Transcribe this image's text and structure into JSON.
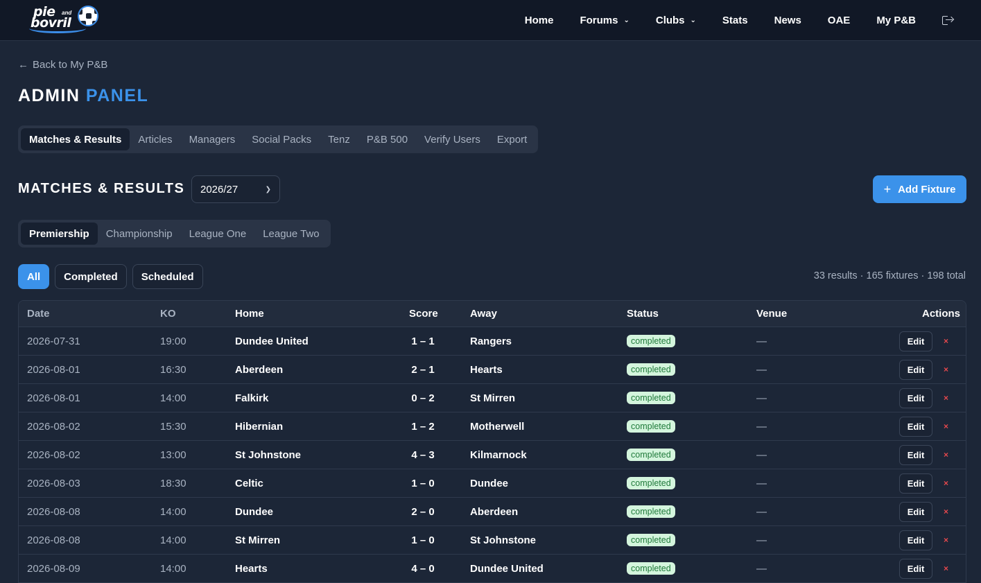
{
  "nav": {
    "logo": {
      "line1": "pie",
      "line2": "bovril",
      "small": "and"
    },
    "items": [
      {
        "label": "Home",
        "dropdown": false
      },
      {
        "label": "Forums",
        "dropdown": true
      },
      {
        "label": "Clubs",
        "dropdown": true
      },
      {
        "label": "Stats",
        "dropdown": false
      },
      {
        "label": "News",
        "dropdown": false
      },
      {
        "label": "OAE",
        "dropdown": false
      },
      {
        "label": "My P&B",
        "dropdown": false
      }
    ],
    "logout_icon": "logout-icon"
  },
  "back_link": "Back to My P&B",
  "title": {
    "main": "ADMIN",
    "accent": "PANEL"
  },
  "tabs": [
    "Matches & Results",
    "Articles",
    "Managers",
    "Social Packs",
    "Tenz",
    "P&B 500",
    "Verify Users",
    "Export"
  ],
  "active_tab": 0,
  "section": {
    "title": "MATCHES & RESULTS",
    "season": "2026/27",
    "add_button": "Add Fixture"
  },
  "leagues": [
    "Premiership",
    "Championship",
    "League One",
    "League Two"
  ],
  "active_league": 0,
  "filters": [
    "All",
    "Completed",
    "Scheduled"
  ],
  "active_filter": 0,
  "summary": "33 results · 165 fixtures · 198 total",
  "table": {
    "headers": {
      "date": "Date",
      "ko": "KO",
      "home": "Home",
      "score": "Score",
      "away": "Away",
      "status": "Status",
      "venue": "Venue",
      "actions": "Actions"
    },
    "edit_label": "Edit",
    "delete_label": "×",
    "rows": [
      {
        "date": "2026-07-31",
        "ko": "19:00",
        "home": "Dundee United",
        "score": "1 – 1",
        "away": "Rangers",
        "status": "completed",
        "venue": "—"
      },
      {
        "date": "2026-08-01",
        "ko": "16:30",
        "home": "Aberdeen",
        "score": "2 – 1",
        "away": "Hearts",
        "status": "completed",
        "venue": "—"
      },
      {
        "date": "2026-08-01",
        "ko": "14:00",
        "home": "Falkirk",
        "score": "0 – 2",
        "away": "St Mirren",
        "status": "completed",
        "venue": "—"
      },
      {
        "date": "2026-08-02",
        "ko": "15:30",
        "home": "Hibernian",
        "score": "1 – 2",
        "away": "Motherwell",
        "status": "completed",
        "venue": "—"
      },
      {
        "date": "2026-08-02",
        "ko": "13:00",
        "home": "St Johnstone",
        "score": "4 – 3",
        "away": "Kilmarnock",
        "status": "completed",
        "venue": "—"
      },
      {
        "date": "2026-08-03",
        "ko": "18:30",
        "home": "Celtic",
        "score": "1 – 0",
        "away": "Dundee",
        "status": "completed",
        "venue": "—"
      },
      {
        "date": "2026-08-08",
        "ko": "14:00",
        "home": "Dundee",
        "score": "2 – 0",
        "away": "Aberdeen",
        "status": "completed",
        "venue": "—"
      },
      {
        "date": "2026-08-08",
        "ko": "14:00",
        "home": "St Mirren",
        "score": "1 – 0",
        "away": "St Johnstone",
        "status": "completed",
        "venue": "—"
      },
      {
        "date": "2026-08-09",
        "ko": "14:00",
        "home": "Hearts",
        "score": "4 – 0",
        "away": "Dundee United",
        "status": "completed",
        "venue": "—"
      }
    ]
  },
  "colors": {
    "accent": "#3b92ea",
    "background": "#1c2637",
    "nav": "#111826",
    "badge_bg": "#d4f5dd",
    "badge_text": "#1f7a3a",
    "delete": "#e5484d"
  }
}
